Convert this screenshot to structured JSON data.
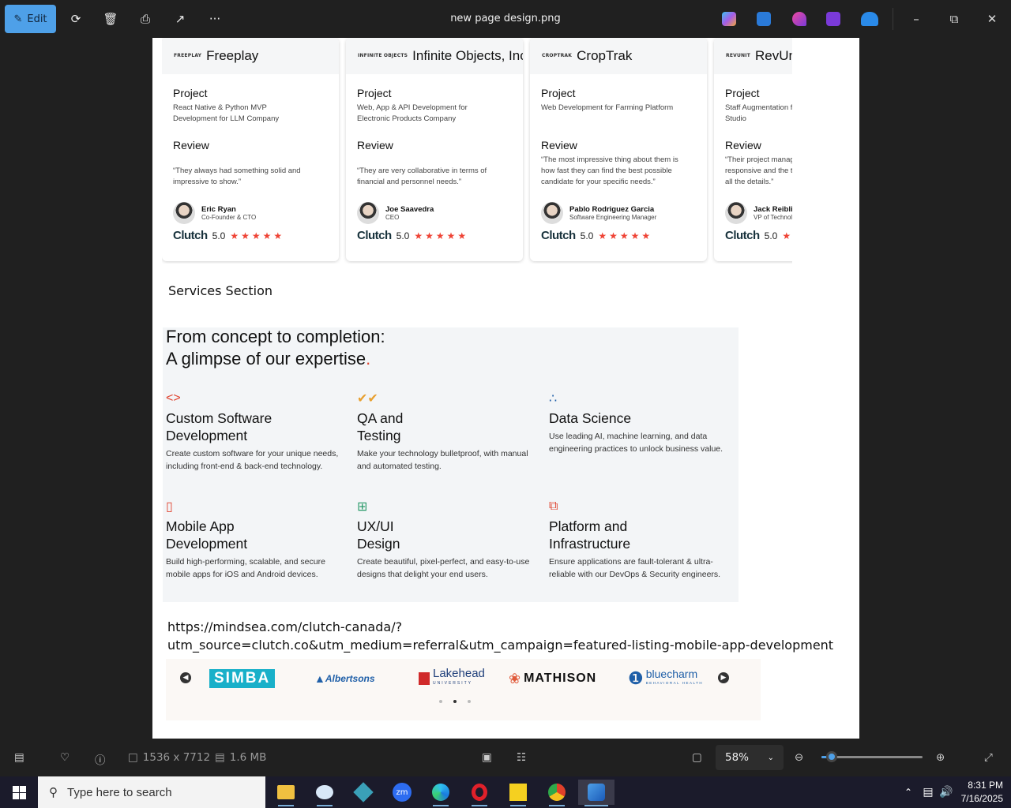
{
  "titlebar": {
    "edit_label": "Edit",
    "file_title": "new page design.png"
  },
  "cards": [
    {
      "logo_text": "FREEPLAY",
      "company": "Freeplay",
      "project_label": "Project",
      "project_desc": [
        "React Native & Python MVP",
        "Development for LLM Company"
      ],
      "review_label": "Review",
      "review_text": [
        "“They always had something solid and",
        "impressive to show.”"
      ],
      "person": "Eric Ryan",
      "role": "Co-Founder & CTO",
      "clutch": "Clutch",
      "rating": "5.0"
    },
    {
      "logo_text": "INFINITE OBJECTS",
      "company": "Infinite Objects, Inc",
      "project_label": "Project",
      "project_desc": [
        "Web, App & API Development for",
        "Electronic Products Company"
      ],
      "review_label": "Review",
      "review_text": [
        "“They are very collaborative in terms of",
        "financial and personnel needs.”"
      ],
      "person": "Joe Saavedra",
      "role": "CEO",
      "clutch": "Clutch",
      "rating": "5.0"
    },
    {
      "logo_text": "CROPTRAK",
      "company": "CropTrak",
      "project_label": "Project",
      "project_desc": [
        "Web Development for Farming Platform"
      ],
      "review_label": "Review",
      "review_text": [
        "“The most impressive thing about them is",
        "how fast they can find the best possible",
        "candidate for your specific needs.”"
      ],
      "person": "Pablo Rodriguez Garcia",
      "role": "Software Engineering Manager",
      "clutch": "Clutch",
      "rating": "5.0"
    },
    {
      "logo_text": "REVUNIT",
      "company": "RevUnit",
      "project_label": "Project",
      "project_desc": [
        "Staff Augmentation for",
        "Studio"
      ],
      "review_label": "Review",
      "review_text": [
        "“Their project manager",
        "responsive and the team",
        "all the details.”"
      ],
      "person": "Jack Reibling",
      "role": "VP of Technology",
      "clutch": "Clutch",
      "rating": "5.0"
    }
  ],
  "section_label": "Services Section",
  "services": {
    "title_line1": "From concept to completion:",
    "title_line2": "A glimpse of our expertise",
    "title_dot": ".",
    "items": [
      {
        "icon": "code-icon",
        "glyph": "<>",
        "color": "#e0432f",
        "name_lines": [
          "Custom Software",
          "Development"
        ],
        "desc": [
          "Create custom software for your unique needs,",
          "including front-end & back-end technology."
        ]
      },
      {
        "icon": "double-check-icon",
        "glyph": "✔✔",
        "color": "#e8a030",
        "name_lines": [
          "QA and",
          "Testing"
        ],
        "desc": [
          "Make your technology bulletproof, with manual",
          "and automated testing."
        ]
      },
      {
        "icon": "molecule-icon",
        "glyph": "∴",
        "color": "#1f5fa8",
        "name_lines": [
          "Data Science"
        ],
        "desc": [
          "Use leading AI, machine learning, and data",
          "engineering practices to unlock business value."
        ]
      },
      {
        "icon": "mobile-icon",
        "glyph": "▯",
        "color": "#e0432f",
        "name_lines": [
          "Mobile App",
          "Development"
        ],
        "desc": [
          "Build high-performing, scalable, and secure",
          "mobile apps for iOS and Android devices."
        ]
      },
      {
        "icon": "layout-grid-icon",
        "glyph": "⊞",
        "color": "#2a9a6a",
        "name_lines": [
          "UX/UI",
          "Design"
        ],
        "desc": [
          "Create beautiful, pixel-perfect, and easy-to-use",
          "designs that delight your end users."
        ]
      },
      {
        "icon": "layers-icon",
        "glyph": "⧉",
        "color": "#e0432f",
        "name_lines": [
          "Platform and",
          "Infrastructure"
        ],
        "desc": [
          "Ensure applications are fault-tolerant & ultra-",
          "reliable with our DevOps & Security engineers."
        ]
      }
    ]
  },
  "url_lines": [
    "https://mindsea.com/clutch-canada/?",
    "utm_source=clutch.co&utm_medium=referral&utm_campaign=featured-listing-mobile-app-development"
  ],
  "client_logos": [
    {
      "name": "SIMBA",
      "color": "#19b0c9"
    },
    {
      "name": "Albertsons",
      "color": "#1f5fa8"
    },
    {
      "name": "Lakehead",
      "sub": "UNIVERSITY",
      "color": "#1f3f7a"
    },
    {
      "name": "MATHISON",
      "color": "#111111"
    },
    {
      "name": "bluecharm",
      "sub": "BEHAVIORAL HEALTH",
      "color": "#1f5fa8"
    }
  ],
  "statusbar": {
    "dimensions": "1536 x 7712",
    "filesize": "1.6 MB",
    "zoom": "58%",
    "zoom_fraction": 0.1
  },
  "taskbar": {
    "search_placeholder": "Type here to search",
    "time": "8:31 PM",
    "date": "7/16/2025"
  },
  "colors": {
    "accent": "#4ea0e8",
    "star": "#ef4335",
    "brand_red": "#e0432f"
  }
}
